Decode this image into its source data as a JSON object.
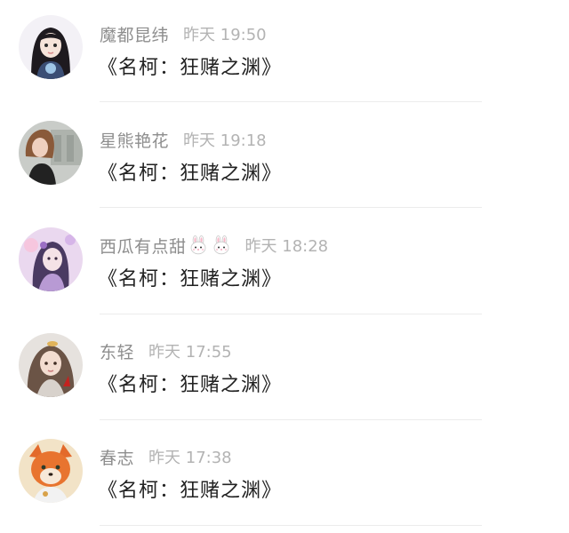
{
  "comments": [
    {
      "username": "魔都昆纬",
      "time": "昨天 19:50",
      "text": "《名柯：狂赌之渊》",
      "badges": []
    },
    {
      "username": "星熊艳花",
      "time": "昨天 19:18",
      "text": "《名柯：狂赌之渊》",
      "badges": []
    },
    {
      "username": "西瓜有点甜",
      "time": "昨天 18:28",
      "text": "《名柯：狂赌之渊》",
      "badges": [
        "rabbit-face-icon",
        "rabbit-face-icon"
      ]
    },
    {
      "username": "东轻",
      "time": "昨天 17:55",
      "text": "《名柯：狂赌之渊》",
      "badges": []
    },
    {
      "username": "春志",
      "time": "昨天 17:38",
      "text": "《名柯：狂赌之渊》",
      "badges": []
    }
  ]
}
